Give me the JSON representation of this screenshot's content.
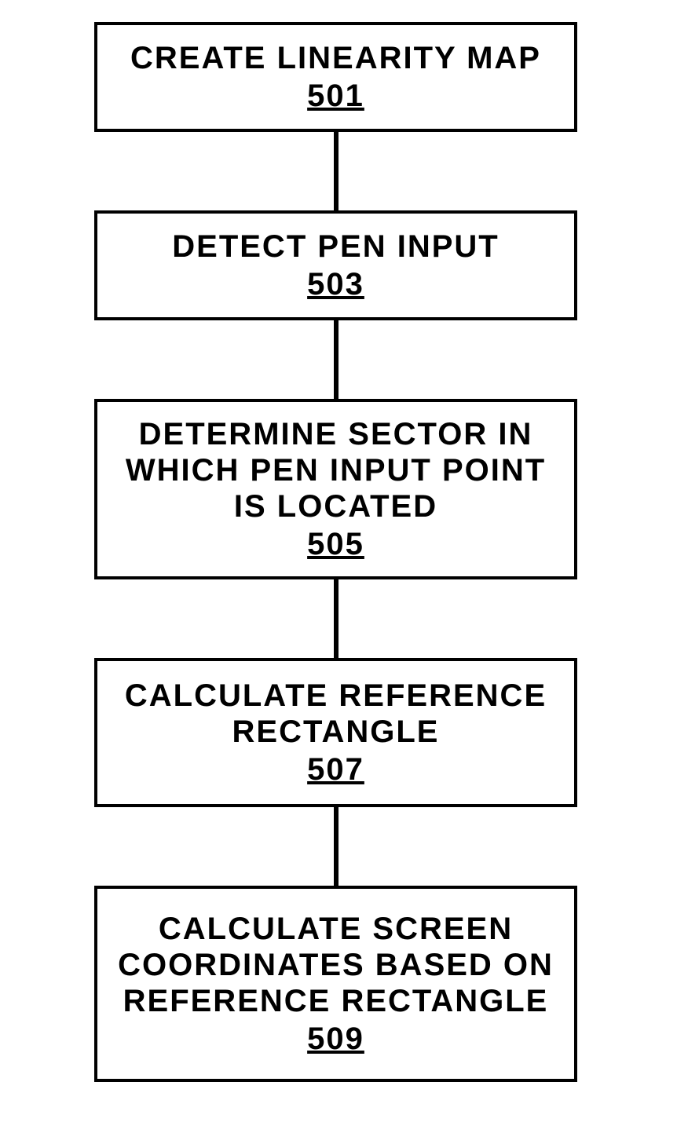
{
  "flow": {
    "steps": [
      {
        "label": "CREATE LINEARITY MAP",
        "ref": "501"
      },
      {
        "label": "DETECT PEN INPUT",
        "ref": "503"
      },
      {
        "label": "DETERMINE SECTOR IN WHICH PEN INPUT POINT IS LOCATED",
        "ref": "505"
      },
      {
        "label": "CALCULATE REFERENCE RECTANGLE",
        "ref": "507"
      },
      {
        "label": "CALCULATE SCREEN COORDINATES BASED ON REFERENCE RECTANGLE",
        "ref": "509"
      }
    ]
  }
}
